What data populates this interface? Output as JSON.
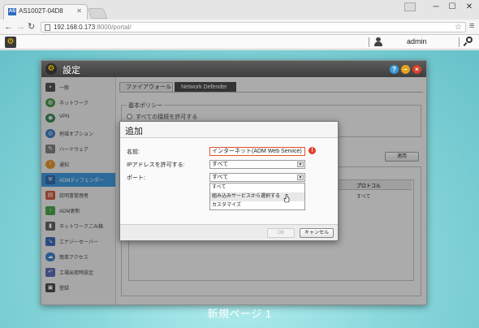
{
  "browser": {
    "tab_title": "AS1002T-04D8",
    "favicon_text": "AS",
    "url_host": "192.168.0.173",
    "url_path": ":8000/portal/",
    "window_buttons": [
      "─",
      "☐",
      "✕"
    ]
  },
  "adm_bar": {
    "username": "admin"
  },
  "desktop": {
    "page_name": "新規ページ 1"
  },
  "settings_window": {
    "title": "設定",
    "controls": [
      "?",
      "−",
      "×"
    ],
    "sidebar": [
      {
        "label": "一般",
        "icon": "monitor-icon",
        "color": "#444444"
      },
      {
        "label": "ネットワーク",
        "icon": "globe-icon",
        "color": "#3b8a3b"
      },
      {
        "label": "VPN",
        "icon": "vpn-icon",
        "color": "#2a7a45"
      },
      {
        "label": "地域オプション",
        "icon": "region-icon",
        "color": "#2d6fb5"
      },
      {
        "label": "ハードウェア",
        "icon": "hardware-icon",
        "color": "#777777"
      },
      {
        "label": "通知",
        "icon": "notification-icon",
        "color": "#d98a1f"
      },
      {
        "label": "ADMディフェンダー",
        "icon": "shield-icon",
        "color": "#2a6ec0"
      },
      {
        "label": "証明書管理者",
        "icon": "certificate-icon",
        "color": "#cc4a2c"
      },
      {
        "label": "ADM更新",
        "icon": "update-icon",
        "color": "#3b9c3b"
      },
      {
        "label": "ネットワークごみ箱",
        "icon": "trash-icon",
        "color": "#555555"
      },
      {
        "label": "エナジーセーバー",
        "icon": "energy-icon",
        "color": "#2d5fb0"
      },
      {
        "label": "簡単アクセス",
        "icon": "cloud-icon",
        "color": "#2f78c4"
      },
      {
        "label": "工場出荷時設定",
        "icon": "reset-icon",
        "color": "#4b60b0"
      },
      {
        "label": "登録",
        "icon": "register-icon",
        "color": "#3a3a3a"
      }
    ],
    "active_sidebar_index": 6,
    "tabs": [
      "ファイアウォール",
      "Network Defender"
    ],
    "active_tab_index": 1,
    "basic_policy": {
      "legend": "基本ポリシー",
      "option": "すべての接続を許可する"
    },
    "apply_button": "適用",
    "table": {
      "headers": [
        "プロトコル"
      ],
      "rows": [
        [
          "すべて"
        ]
      ]
    }
  },
  "dialog": {
    "title": "追加",
    "name_label": "名前:",
    "name_value": "インターネット(ADM Web Service)",
    "ip_label": "IPアドレスを許可する:",
    "ip_value": "すべて",
    "port_label": "ポート:",
    "port_value": "すべて",
    "port_options": [
      "すべて",
      "組み込みサービスから選択する",
      "カスタマイズ"
    ],
    "hovered_option_index": 1,
    "ok_button": "OK",
    "cancel_button": "キャンセル"
  }
}
